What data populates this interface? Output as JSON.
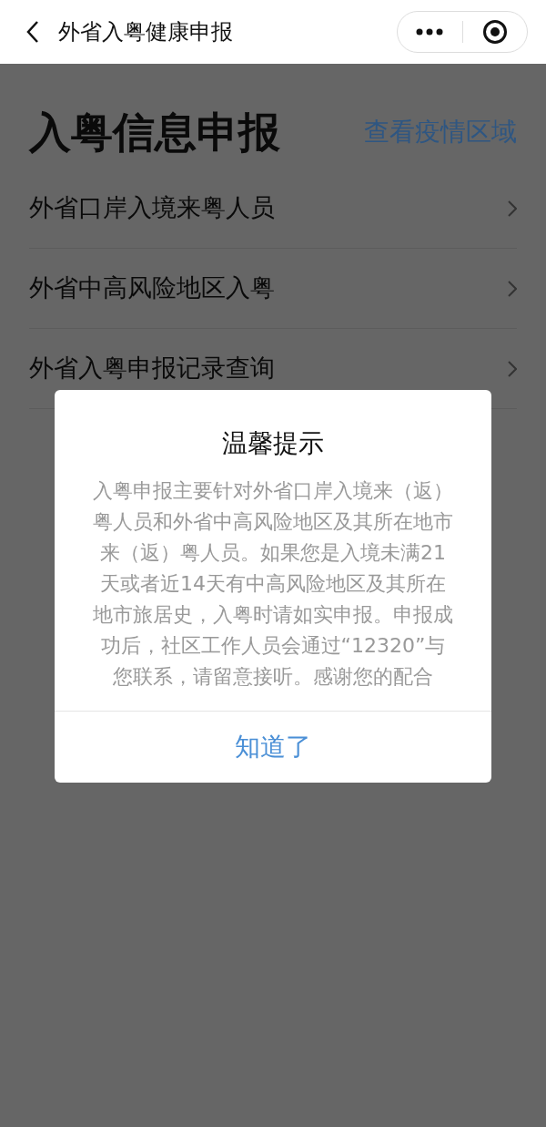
{
  "nav": {
    "title": "外省入粤健康申报"
  },
  "page": {
    "heading": "入粤信息申报",
    "link": "查看疫情区域",
    "items": [
      {
        "label": "外省口岸入境来粤人员"
      },
      {
        "label": "外省中高风险地区入粤"
      },
      {
        "label": "外省入粤申报记录查询"
      }
    ]
  },
  "dialog": {
    "title": "温馨提示",
    "message": "入粤申报主要针对外省口岸入境来（返）粤人员和外省中高风险地区及其所在地市来（返）粤人员。如果您是入境未满21天或者近14天有中高风险地区及其所在地市旅居史，入粤时请如实申报。申报成功后，社区工作人员会通过“12320”与您联系，请留意接听。感谢您的配合",
    "button": "知道了"
  }
}
